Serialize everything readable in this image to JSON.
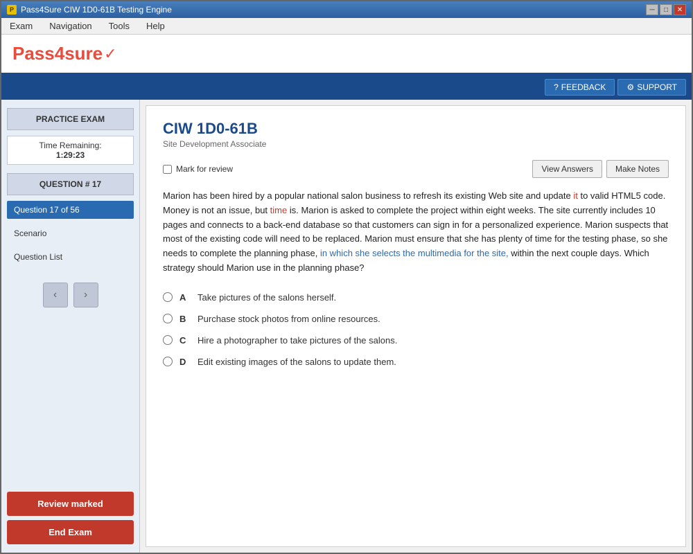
{
  "window": {
    "title": "Pass4Sure CIW 1D0-61B Testing Engine"
  },
  "titlebar": {
    "minimize": "─",
    "maximize": "□",
    "close": "✕"
  },
  "menu": {
    "items": [
      "Exam",
      "Navigation",
      "Tools",
      "Help"
    ]
  },
  "logo": {
    "text_part1": "Pass",
    "text_part2": "4sure",
    "checkmark": "✓"
  },
  "header_actions": {
    "feedback_icon": "?",
    "feedback_label": "FEEDBACK",
    "support_icon": "⚙",
    "support_label": "SUPPORT"
  },
  "sidebar": {
    "practice_exam_label": "PRACTICE EXAM",
    "time_remaining_label": "Time Remaining:",
    "time_value": "1:29:23",
    "question_label": "QUESTION # 17",
    "nav_items": [
      {
        "label": "Question 17 of 56",
        "active": true
      },
      {
        "label": "Scenario",
        "active": false
      },
      {
        "label": "Question List",
        "active": false
      }
    ],
    "prev_arrow": "‹",
    "next_arrow": "›",
    "review_marked_btn": "Review marked",
    "end_exam_btn": "End Exam"
  },
  "content": {
    "exam_title": "CIW 1D0-61B",
    "exam_subtitle": "Site Development Associate",
    "mark_review_label": "Mark for review",
    "view_answers_btn": "View Answers",
    "make_notes_btn": "Make Notes",
    "question_text": "Marion has been hired by a popular national salon business to refresh its existing Web site and update it to valid HTML5 code. Money is not an issue, but time is. Marion is asked to complete the project within eight weeks. The site currently includes 10 pages and connects to a back-end database so that customers can sign in for a personalized experience. Marion suspects that most of the existing code will need to be replaced. Marion must ensure that she has plenty of time for the testing phase, so she needs to complete the planning phase, in which she selects the multimedia for the site, within the next couple days. Which strategy should Marion use in the planning phase?",
    "options": [
      {
        "letter": "A",
        "text": "Take pictures of the salons herself."
      },
      {
        "letter": "B",
        "text": "Purchase stock photos from online resources."
      },
      {
        "letter": "C",
        "text": "Hire a photographer to take pictures of the salons."
      },
      {
        "letter": "D",
        "text": "Edit existing images of the salons to update them."
      }
    ]
  }
}
